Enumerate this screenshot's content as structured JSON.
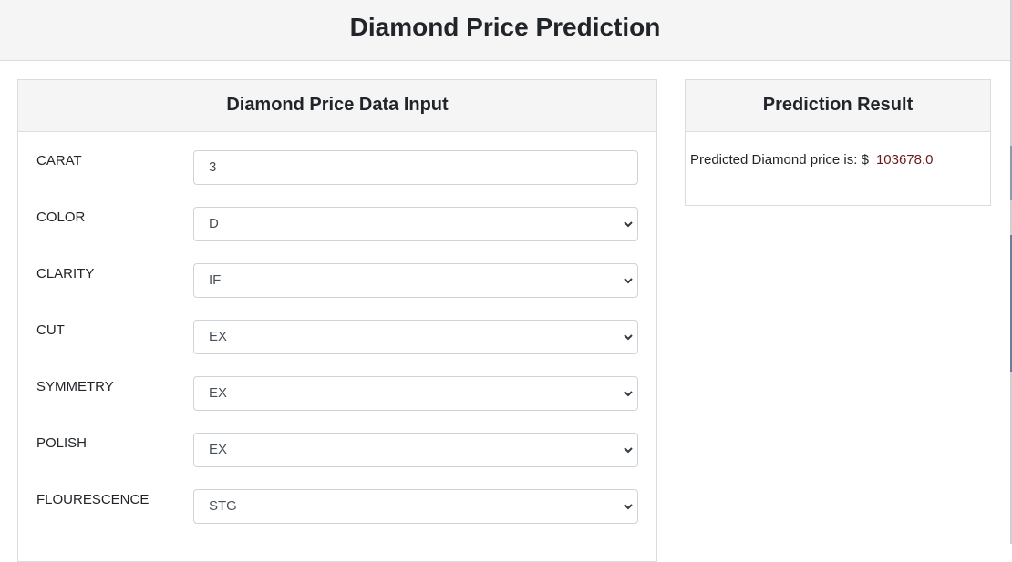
{
  "header": {
    "title": "Diamond Price Prediction"
  },
  "input_card": {
    "title": "Diamond Price Data Input",
    "fields": [
      {
        "label": "CARAT",
        "value": "3",
        "type": "text"
      },
      {
        "label": "COLOR",
        "value": "D",
        "type": "select"
      },
      {
        "label": "CLARITY",
        "value": "IF",
        "type": "select"
      },
      {
        "label": "CUT",
        "value": "EX",
        "type": "select"
      },
      {
        "label": "SYMMETRY",
        "value": "EX",
        "type": "select"
      },
      {
        "label": "POLISH",
        "value": "EX",
        "type": "select"
      },
      {
        "label": "FLOURESCENCE",
        "value": "STG",
        "type": "select"
      }
    ]
  },
  "result_card": {
    "title": "Prediction Result",
    "label": "Predicted Diamond price is: $",
    "value": "103678.0"
  },
  "icons": {
    "select_arrow": "chevron-down-icon"
  },
  "colors": {
    "result_value": "#6b1a1a",
    "header_bg": "#f5f5f5"
  }
}
